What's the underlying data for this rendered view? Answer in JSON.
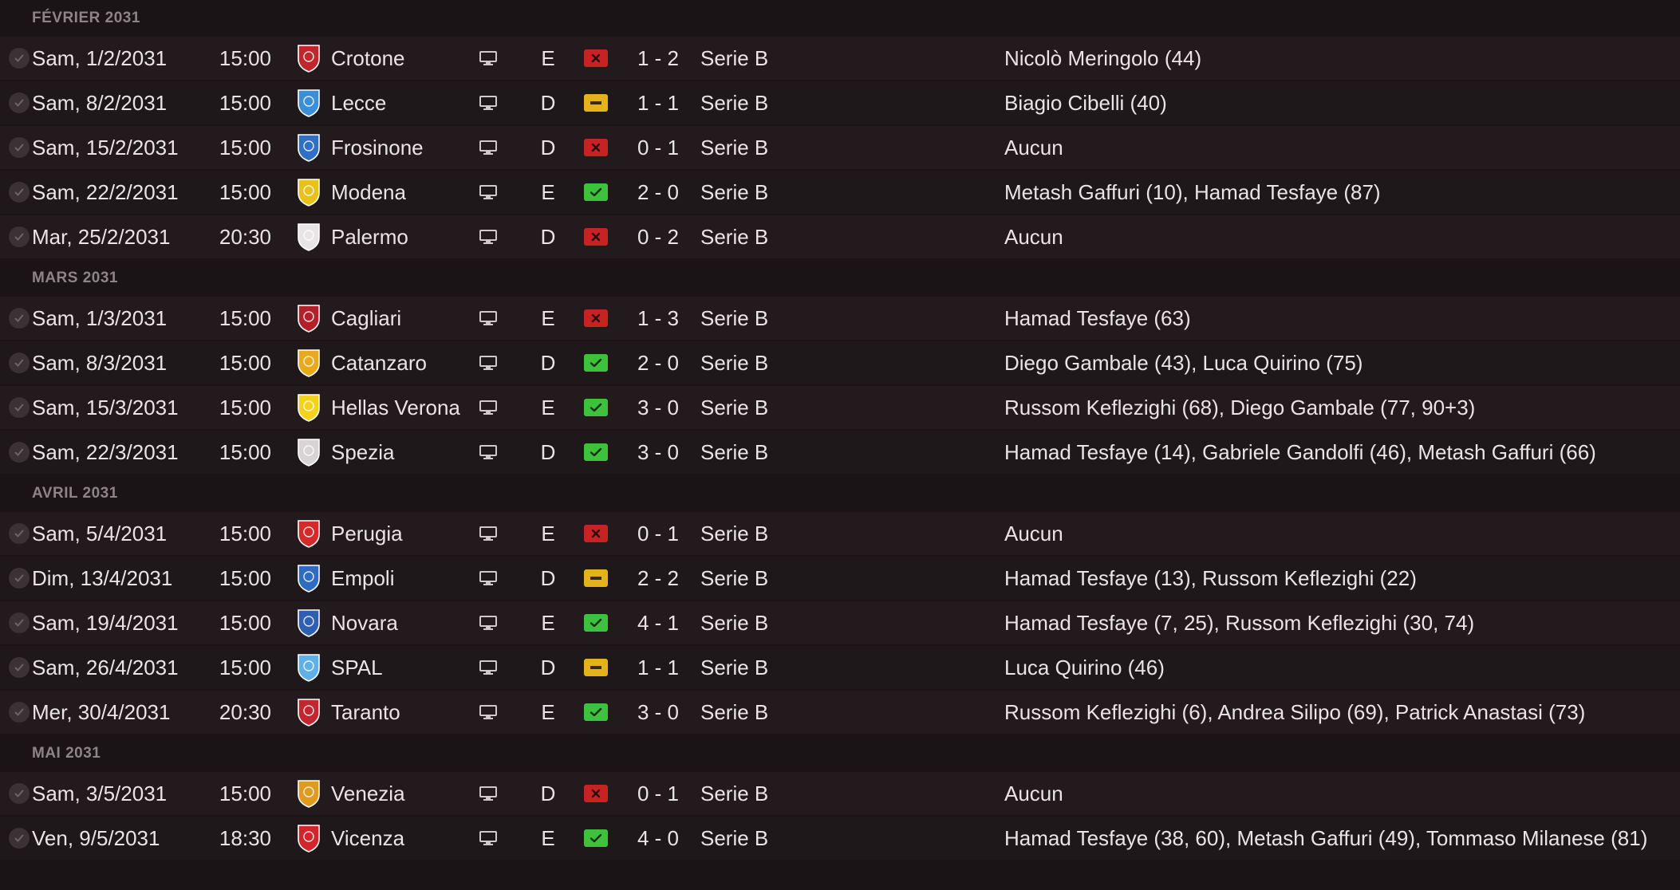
{
  "months": [
    {
      "label": "FÉVRIER 2031",
      "matches": [
        {
          "date": "Sam, 1/2/2031",
          "time": "15:00",
          "team": "Crotone",
          "badge_color": "#c0272d",
          "side": "E",
          "result": "L",
          "score": "1 - 2",
          "competition": "Serie B",
          "scorers": "Nicolò Meringolo (44)"
        },
        {
          "date": "Sam, 8/2/2031",
          "time": "15:00",
          "team": "Lecce",
          "badge_color": "#3a8fd6",
          "side": "D",
          "result": "N",
          "score": "1 - 1",
          "competition": "Serie B",
          "scorers": "Biagio Cibelli (40)"
        },
        {
          "date": "Sam, 15/2/2031",
          "time": "15:00",
          "team": "Frosinone",
          "badge_color": "#2f6fc4",
          "side": "D",
          "result": "L",
          "score": "0 - 1",
          "competition": "Serie B",
          "scorers": "Aucun"
        },
        {
          "date": "Sam, 22/2/2031",
          "time": "15:00",
          "team": "Modena",
          "badge_color": "#e8c21a",
          "side": "E",
          "result": "V",
          "score": "2 - 0",
          "competition": "Serie B",
          "scorers": "Metash Gaffuri (10), Hamad Tesfaye (87)"
        },
        {
          "date": "Mar, 25/2/2031",
          "time": "20:30",
          "team": "Palermo",
          "badge_color": "#e9e4e6",
          "side": "D",
          "result": "L",
          "score": "0 - 2",
          "competition": "Serie B",
          "scorers": "Aucun"
        }
      ]
    },
    {
      "label": "MARS 2031",
      "matches": [
        {
          "date": "Sam, 1/3/2031",
          "time": "15:00",
          "team": "Cagliari",
          "badge_color": "#b3202a",
          "side": "E",
          "result": "L",
          "score": "1 - 3",
          "competition": "Serie B",
          "scorers": "Hamad Tesfaye (63)"
        },
        {
          "date": "Sam, 8/3/2031",
          "time": "15:00",
          "team": "Catanzaro",
          "badge_color": "#e8a91c",
          "side": "D",
          "result": "V",
          "score": "2 - 0",
          "competition": "Serie B",
          "scorers": "Diego Gambale (43), Luca Quirino (75)"
        },
        {
          "date": "Sam, 15/3/2031",
          "time": "15:00",
          "team": "Hellas Verona",
          "badge_color": "#f2d21b",
          "side": "E",
          "result": "V",
          "score": "3 - 0",
          "competition": "Serie B",
          "scorers": "Russom Keflezighi (68), Diego Gambale (77, 90+3)"
        },
        {
          "date": "Sam, 22/3/2031",
          "time": "15:00",
          "team": "Spezia",
          "badge_color": "#d8d3d5",
          "side": "D",
          "result": "V",
          "score": "3 - 0",
          "competition": "Serie B",
          "scorers": "Hamad Tesfaye (14), Gabriele Gandolfi (46), Metash Gaffuri (66)"
        }
      ]
    },
    {
      "label": "AVRIL 2031",
      "matches": [
        {
          "date": "Sam, 5/4/2031",
          "time": "15:00",
          "team": "Perugia",
          "badge_color": "#d42a2a",
          "side": "E",
          "result": "L",
          "score": "0 - 1",
          "competition": "Serie B",
          "scorers": "Aucun"
        },
        {
          "date": "Dim, 13/4/2031",
          "time": "15:00",
          "team": "Empoli",
          "badge_color": "#2e6bc2",
          "side": "D",
          "result": "N",
          "score": "2 - 2",
          "competition": "Serie B",
          "scorers": "Hamad Tesfaye (13), Russom Keflezighi (22)"
        },
        {
          "date": "Sam, 19/4/2031",
          "time": "15:00",
          "team": "Novara",
          "badge_color": "#2f5fb5",
          "side": "E",
          "result": "V",
          "score": "4 - 1",
          "competition": "Serie B",
          "scorers": "Hamad Tesfaye (7, 25), Russom Keflezighi (30, 74)"
        },
        {
          "date": "Sam, 26/4/2031",
          "time": "15:00",
          "team": "SPAL",
          "badge_color": "#5fb0e6",
          "side": "D",
          "result": "N",
          "score": "1 - 1",
          "competition": "Serie B",
          "scorers": "Luca Quirino (46)"
        },
        {
          "date": "Mer, 30/4/2031",
          "time": "20:30",
          "team": "Taranto",
          "badge_color": "#c2262e",
          "side": "E",
          "result": "V",
          "score": "3 - 0",
          "competition": "Serie B",
          "scorers": "Russom Keflezighi (6), Andrea Silipo (69), Patrick Anastasi (73)"
        }
      ]
    },
    {
      "label": "MAI 2031",
      "matches": [
        {
          "date": "Sam, 3/5/2031",
          "time": "15:00",
          "team": "Venezia",
          "badge_color": "#e09a1f",
          "side": "D",
          "result": "L",
          "score": "0 - 1",
          "competition": "Serie B",
          "scorers": "Aucun"
        },
        {
          "date": "Ven, 9/5/2031",
          "time": "18:30",
          "team": "Vicenza",
          "badge_color": "#d0262b",
          "side": "E",
          "result": "V",
          "score": "4 - 0",
          "competition": "Serie B",
          "scorers": "Hamad Tesfaye (38, 60), Metash Gaffuri (49), Tommaso Milanese (81)"
        }
      ]
    }
  ],
  "icons": {
    "check": "check-circle-icon",
    "venue": "monitor-icon",
    "result_L": "defeat-x-icon",
    "result_N": "draw-dash-icon",
    "result_V": "win-check-icon"
  },
  "colors": {
    "loss": "#c82323",
    "draw": "#e5b21c",
    "win": "#3ec23e"
  }
}
